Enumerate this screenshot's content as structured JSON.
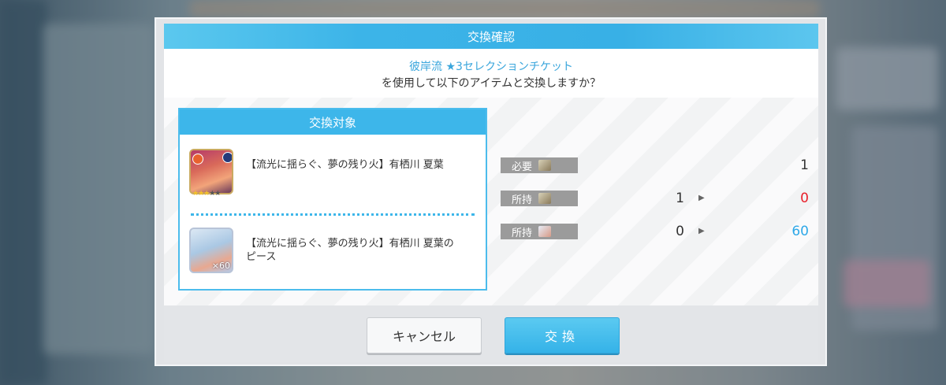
{
  "dialog": {
    "title": "交換確認",
    "ticket_name": "彼岸流 ★3セレクションチケット",
    "question": "を使用して以下のアイテムと交換しますか？"
  },
  "target": {
    "header": "交換対象",
    "items": [
      {
        "name": "【流光に揺らぐ、夢の残り火】有栖川 夏葉",
        "icon": "card-icon",
        "rarity": 3,
        "max_rarity": 5
      },
      {
        "name": "【流光に揺らぐ、夢の残り火】有栖川 夏葉のピース",
        "icon": "piece-icon",
        "quantity": "×60"
      }
    ]
  },
  "summary": {
    "required": {
      "label": "必要",
      "icon": "ticket-icon",
      "value": "1"
    },
    "owned_ticket": {
      "label": "所持",
      "icon": "ticket-icon",
      "before": "1",
      "after": "0",
      "after_color": "#e8202a"
    },
    "owned_piece": {
      "label": "所持",
      "icon": "piece-icon",
      "before": "0",
      "after": "60",
      "after_color": "#2ea8e8"
    }
  },
  "buttons": {
    "cancel": "キャンセル",
    "confirm": "交換"
  }
}
